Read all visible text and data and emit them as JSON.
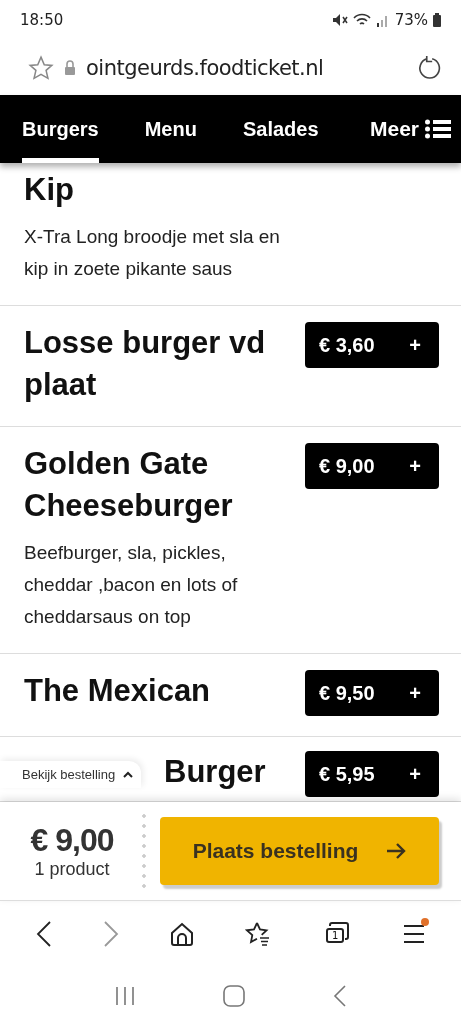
{
  "status_bar": {
    "time": "18:50",
    "battery": "73%"
  },
  "address_bar": {
    "url": "ointgeurds.foodticket.nl"
  },
  "tabs": [
    {
      "label": "Burgers",
      "selected": true
    },
    {
      "label": "Menu",
      "selected": false
    },
    {
      "label": "Salades",
      "selected": false
    }
  ],
  "more_button": {
    "label": "Meer"
  },
  "items": [
    {
      "title": "Kip",
      "description": "X-Tra Long broodje met sla en kip in zoete pikante saus"
    },
    {
      "title": "Losse burger vd plaat",
      "price": "€ 3,60",
      "add": "+"
    },
    {
      "title": "Golden Gate Cheeseburger",
      "description": "Beefburger, sla, pickles, cheddar ,bacon en lots of cheddarsaus on top",
      "price": "€ 9,00",
      "add": "+"
    },
    {
      "title": "The Mexican",
      "price": "€ 9,50",
      "add": "+"
    },
    {
      "title": "Burger",
      "price": "€ 5,95",
      "add": "+"
    }
  ],
  "order_bar": {
    "toggle": "Bekijk bestelling",
    "total": "€ 9,00",
    "count": "1 product",
    "button": "Plaats bestelling"
  },
  "browser_toolbar": {
    "tab_count": "1"
  }
}
